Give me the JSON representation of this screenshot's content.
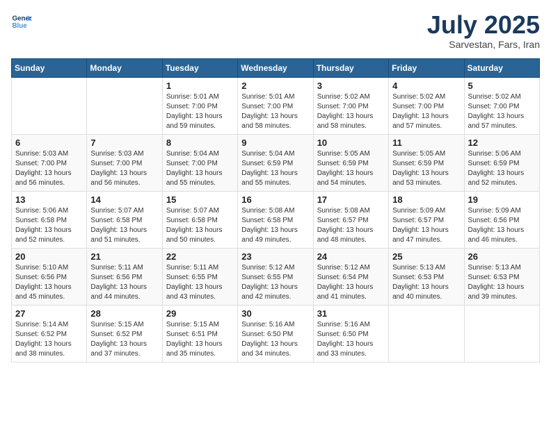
{
  "header": {
    "logo_line1": "General",
    "logo_line2": "Blue",
    "month_year": "July 2025",
    "location": "Sarvestan, Fars, Iran"
  },
  "weekdays": [
    "Sunday",
    "Monday",
    "Tuesday",
    "Wednesday",
    "Thursday",
    "Friday",
    "Saturday"
  ],
  "weeks": [
    [
      {
        "day": "",
        "info": ""
      },
      {
        "day": "",
        "info": ""
      },
      {
        "day": "1",
        "info": "Sunrise: 5:01 AM\nSunset: 7:00 PM\nDaylight: 13 hours and 59 minutes."
      },
      {
        "day": "2",
        "info": "Sunrise: 5:01 AM\nSunset: 7:00 PM\nDaylight: 13 hours and 58 minutes."
      },
      {
        "day": "3",
        "info": "Sunrise: 5:02 AM\nSunset: 7:00 PM\nDaylight: 13 hours and 58 minutes."
      },
      {
        "day": "4",
        "info": "Sunrise: 5:02 AM\nSunset: 7:00 PM\nDaylight: 13 hours and 57 minutes."
      },
      {
        "day": "5",
        "info": "Sunrise: 5:02 AM\nSunset: 7:00 PM\nDaylight: 13 hours and 57 minutes."
      }
    ],
    [
      {
        "day": "6",
        "info": "Sunrise: 5:03 AM\nSunset: 7:00 PM\nDaylight: 13 hours and 56 minutes."
      },
      {
        "day": "7",
        "info": "Sunrise: 5:03 AM\nSunset: 7:00 PM\nDaylight: 13 hours and 56 minutes."
      },
      {
        "day": "8",
        "info": "Sunrise: 5:04 AM\nSunset: 7:00 PM\nDaylight: 13 hours and 55 minutes."
      },
      {
        "day": "9",
        "info": "Sunrise: 5:04 AM\nSunset: 6:59 PM\nDaylight: 13 hours and 55 minutes."
      },
      {
        "day": "10",
        "info": "Sunrise: 5:05 AM\nSunset: 6:59 PM\nDaylight: 13 hours and 54 minutes."
      },
      {
        "day": "11",
        "info": "Sunrise: 5:05 AM\nSunset: 6:59 PM\nDaylight: 13 hours and 53 minutes."
      },
      {
        "day": "12",
        "info": "Sunrise: 5:06 AM\nSunset: 6:59 PM\nDaylight: 13 hours and 52 minutes."
      }
    ],
    [
      {
        "day": "13",
        "info": "Sunrise: 5:06 AM\nSunset: 6:58 PM\nDaylight: 13 hours and 52 minutes."
      },
      {
        "day": "14",
        "info": "Sunrise: 5:07 AM\nSunset: 6:58 PM\nDaylight: 13 hours and 51 minutes."
      },
      {
        "day": "15",
        "info": "Sunrise: 5:07 AM\nSunset: 6:58 PM\nDaylight: 13 hours and 50 minutes."
      },
      {
        "day": "16",
        "info": "Sunrise: 5:08 AM\nSunset: 6:58 PM\nDaylight: 13 hours and 49 minutes."
      },
      {
        "day": "17",
        "info": "Sunrise: 5:08 AM\nSunset: 6:57 PM\nDaylight: 13 hours and 48 minutes."
      },
      {
        "day": "18",
        "info": "Sunrise: 5:09 AM\nSunset: 6:57 PM\nDaylight: 13 hours and 47 minutes."
      },
      {
        "day": "19",
        "info": "Sunrise: 5:09 AM\nSunset: 6:56 PM\nDaylight: 13 hours and 46 minutes."
      }
    ],
    [
      {
        "day": "20",
        "info": "Sunrise: 5:10 AM\nSunset: 6:56 PM\nDaylight: 13 hours and 45 minutes."
      },
      {
        "day": "21",
        "info": "Sunrise: 5:11 AM\nSunset: 6:56 PM\nDaylight: 13 hours and 44 minutes."
      },
      {
        "day": "22",
        "info": "Sunrise: 5:11 AM\nSunset: 6:55 PM\nDaylight: 13 hours and 43 minutes."
      },
      {
        "day": "23",
        "info": "Sunrise: 5:12 AM\nSunset: 6:55 PM\nDaylight: 13 hours and 42 minutes."
      },
      {
        "day": "24",
        "info": "Sunrise: 5:12 AM\nSunset: 6:54 PM\nDaylight: 13 hours and 41 minutes."
      },
      {
        "day": "25",
        "info": "Sunrise: 5:13 AM\nSunset: 6:53 PM\nDaylight: 13 hours and 40 minutes."
      },
      {
        "day": "26",
        "info": "Sunrise: 5:13 AM\nSunset: 6:53 PM\nDaylight: 13 hours and 39 minutes."
      }
    ],
    [
      {
        "day": "27",
        "info": "Sunrise: 5:14 AM\nSunset: 6:52 PM\nDaylight: 13 hours and 38 minutes."
      },
      {
        "day": "28",
        "info": "Sunrise: 5:15 AM\nSunset: 6:52 PM\nDaylight: 13 hours and 37 minutes."
      },
      {
        "day": "29",
        "info": "Sunrise: 5:15 AM\nSunset: 6:51 PM\nDaylight: 13 hours and 35 minutes."
      },
      {
        "day": "30",
        "info": "Sunrise: 5:16 AM\nSunset: 6:50 PM\nDaylight: 13 hours and 34 minutes."
      },
      {
        "day": "31",
        "info": "Sunrise: 5:16 AM\nSunset: 6:50 PM\nDaylight: 13 hours and 33 minutes."
      },
      {
        "day": "",
        "info": ""
      },
      {
        "day": "",
        "info": ""
      }
    ]
  ]
}
